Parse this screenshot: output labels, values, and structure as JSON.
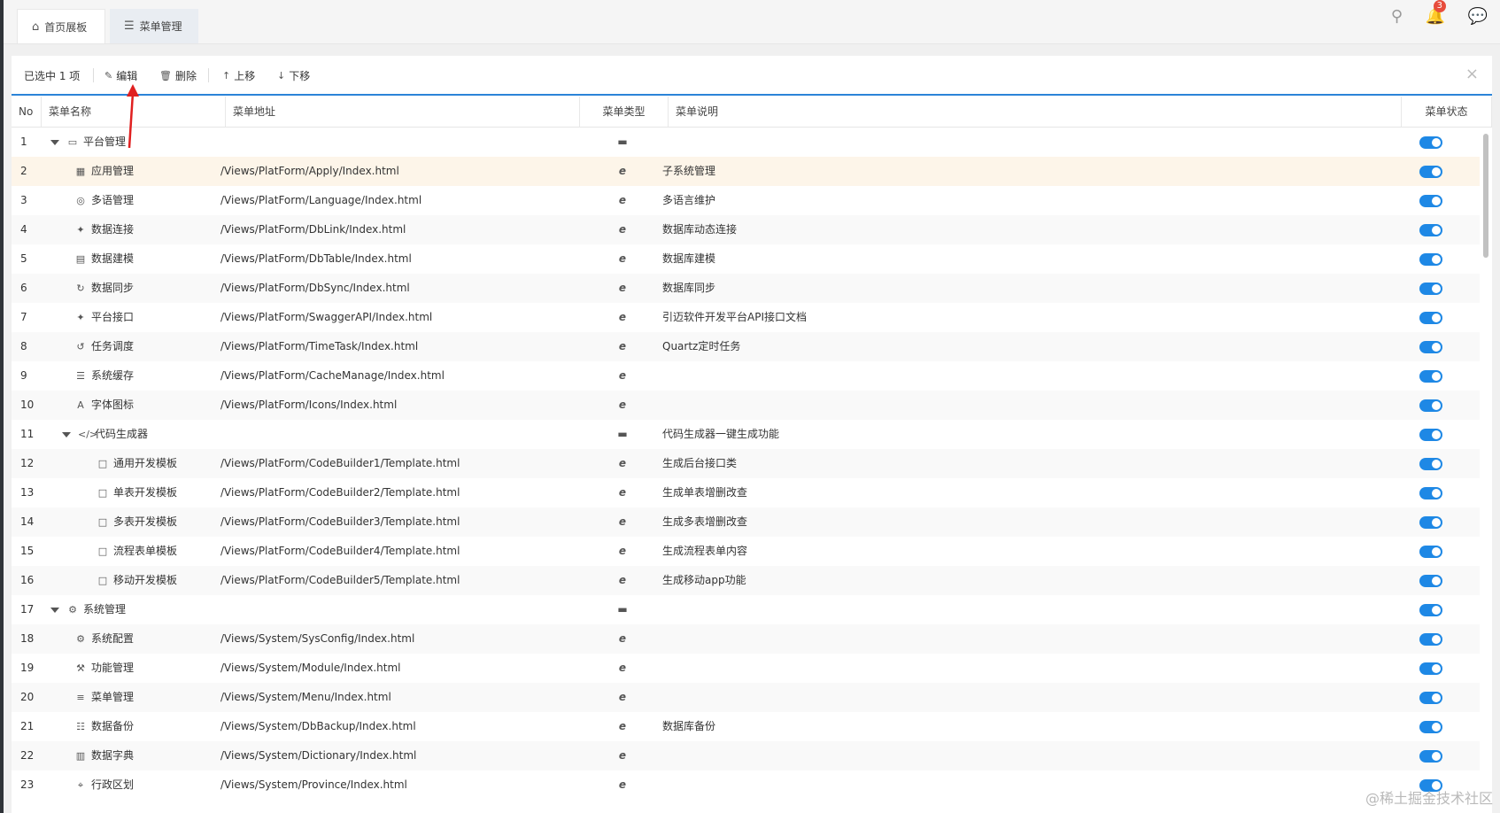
{
  "tabs": [
    {
      "label": "首页展板",
      "icon": "home-icon"
    },
    {
      "label": "菜单管理",
      "icon": "menu-lines-icon"
    }
  ],
  "notifications": {
    "count": "3"
  },
  "toolbar": {
    "selected_text": "已选中 1 项",
    "edit": "编辑",
    "delete": "删除",
    "move_up": "上移",
    "move_down": "下移"
  },
  "columns": {
    "no": "No",
    "name": "菜单名称",
    "url": "菜单地址",
    "type": "菜单类型",
    "desc": "菜单说明",
    "status": "菜单状态"
  },
  "rows": [
    {
      "no": "1",
      "name": "平台管理",
      "level": 0,
      "expand": true,
      "icon": "monitor-icon",
      "url": "",
      "type": "folder",
      "desc": "",
      "enabled": true
    },
    {
      "no": "2",
      "name": "应用管理",
      "level": 1,
      "expand": false,
      "icon": "windows-icon",
      "url": "/Views/PlatForm/Apply/Index.html",
      "type": "page",
      "desc": "子系统管理",
      "enabled": true
    },
    {
      "no": "3",
      "name": "多语管理",
      "level": 1,
      "expand": false,
      "icon": "globe-icon",
      "url": "/Views/PlatForm/Language/Index.html",
      "type": "page",
      "desc": "多语言维护",
      "enabled": true
    },
    {
      "no": "4",
      "name": "数据连接",
      "level": 1,
      "expand": false,
      "icon": "plug-icon",
      "url": "/Views/PlatForm/DbLink/Index.html",
      "type": "page",
      "desc": "数据库动态连接",
      "enabled": true
    },
    {
      "no": "5",
      "name": "数据建模",
      "level": 1,
      "expand": false,
      "icon": "table-icon",
      "url": "/Views/PlatForm/DbTable/Index.html",
      "type": "page",
      "desc": "数据库建模",
      "enabled": true
    },
    {
      "no": "6",
      "name": "数据同步",
      "level": 1,
      "expand": false,
      "icon": "sync-icon",
      "url": "/Views/PlatForm/DbSync/Index.html",
      "type": "page",
      "desc": "数据库同步",
      "enabled": true
    },
    {
      "no": "7",
      "name": "平台接口",
      "level": 1,
      "expand": false,
      "icon": "plug-icon",
      "url": "/Views/PlatForm/SwaggerAPI/Index.html",
      "type": "page",
      "desc": "引迈软件开发平台API接口文档",
      "enabled": true
    },
    {
      "no": "8",
      "name": "任务调度",
      "level": 1,
      "expand": false,
      "icon": "history-icon",
      "url": "/Views/PlatForm/TimeTask/Index.html",
      "type": "page",
      "desc": "Quartz定时任务",
      "enabled": true
    },
    {
      "no": "9",
      "name": "系统缓存",
      "level": 1,
      "expand": false,
      "icon": "list-icon",
      "url": "/Views/PlatForm/CacheManage/Index.html",
      "type": "page",
      "desc": "",
      "enabled": true
    },
    {
      "no": "10",
      "name": "字体图标",
      "level": 1,
      "expand": false,
      "icon": "font-icon",
      "url": "/Views/PlatForm/Icons/Index.html",
      "type": "page",
      "desc": "",
      "enabled": true
    },
    {
      "no": "11",
      "name": "代码生成器",
      "level": 1,
      "expand": true,
      "icon": "code-icon",
      "url": "",
      "type": "folder",
      "desc": "代码生成器一键生成功能",
      "enabled": true
    },
    {
      "no": "12",
      "name": "通用开发模板",
      "level": 2,
      "expand": false,
      "icon": "file-icon",
      "url": "/Views/PlatForm/CodeBuilder1/Template.html",
      "type": "page",
      "desc": "生成后台接口类",
      "enabled": true
    },
    {
      "no": "13",
      "name": "单表开发模板",
      "level": 2,
      "expand": false,
      "icon": "file-icon",
      "url": "/Views/PlatForm/CodeBuilder2/Template.html",
      "type": "page",
      "desc": "生成单表增删改查",
      "enabled": true
    },
    {
      "no": "14",
      "name": "多表开发模板",
      "level": 2,
      "expand": false,
      "icon": "file-icon",
      "url": "/Views/PlatForm/CodeBuilder3/Template.html",
      "type": "page",
      "desc": "生成多表增删改查",
      "enabled": true
    },
    {
      "no": "15",
      "name": "流程表单模板",
      "level": 2,
      "expand": false,
      "icon": "file-icon",
      "url": "/Views/PlatForm/CodeBuilder4/Template.html",
      "type": "page",
      "desc": "生成流程表单内容",
      "enabled": true
    },
    {
      "no": "16",
      "name": "移动开发模板",
      "level": 2,
      "expand": false,
      "icon": "file-icon",
      "url": "/Views/PlatForm/CodeBuilder5/Template.html",
      "type": "page",
      "desc": "生成移动app功能",
      "enabled": true
    },
    {
      "no": "17",
      "name": "系统管理",
      "level": 0,
      "expand": true,
      "icon": "gear-icon",
      "url": "",
      "type": "folder",
      "desc": "",
      "enabled": true
    },
    {
      "no": "18",
      "name": "系统配置",
      "level": 1,
      "expand": false,
      "icon": "gears-icon",
      "url": "/Views/System/SysConfig/Index.html",
      "type": "page",
      "desc": "",
      "enabled": true
    },
    {
      "no": "19",
      "name": "功能管理",
      "level": 1,
      "expand": false,
      "icon": "wrench-icon",
      "url": "/Views/System/Module/Index.html",
      "type": "page",
      "desc": "",
      "enabled": true
    },
    {
      "no": "20",
      "name": "菜单管理",
      "level": 1,
      "expand": false,
      "icon": "menu-lines-icon",
      "url": "/Views/System/Menu/Index.html",
      "type": "page",
      "desc": "",
      "enabled": true
    },
    {
      "no": "21",
      "name": "数据备份",
      "level": 1,
      "expand": false,
      "icon": "database-icon",
      "url": "/Views/System/DbBackup/Index.html",
      "type": "page",
      "desc": "数据库备份",
      "enabled": true
    },
    {
      "no": "22",
      "name": "数据字典",
      "level": 1,
      "expand": false,
      "icon": "book-icon",
      "url": "/Views/System/Dictionary/Index.html",
      "type": "page",
      "desc": "",
      "enabled": true
    },
    {
      "no": "23",
      "name": "行政区划",
      "level": 1,
      "expand": false,
      "icon": "map-pin-icon",
      "url": "/Views/System/Province/Index.html",
      "type": "page",
      "desc": "",
      "enabled": true
    }
  ],
  "selected_row": "2",
  "colors": {
    "accent": "#1e88e5",
    "selected_row": "#fdf5e9",
    "arrow": "#e02020"
  },
  "watermark": "@稀土掘金技术社区"
}
